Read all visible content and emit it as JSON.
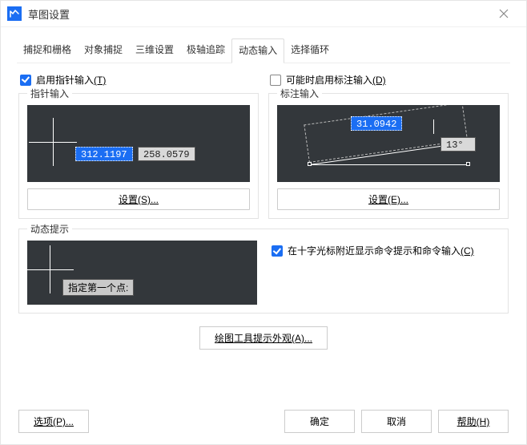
{
  "window": {
    "title": "草图设置"
  },
  "tabs": [
    "捕捉和栅格",
    "对象捕捉",
    "三维设置",
    "极轴追踪",
    "动态输入",
    "选择循环"
  ],
  "active_tab_index": 4,
  "pointer_input": {
    "checkbox_label_pre": "启用指针输入",
    "checkbox_key": "(T)",
    "group_label": "指针输入",
    "val1": "312.1197",
    "val2": "258.0579",
    "settings_btn": "设置(S)..."
  },
  "dim_input": {
    "checkbox_label_pre": "可能时启用标注输入",
    "checkbox_key": "(D)",
    "group_label": "标注输入",
    "len": "31.0942",
    "ang": "13°",
    "settings_btn": "设置(E)..."
  },
  "dyn_prompt": {
    "group_label": "动态提示",
    "hint_text": "指定第一个点:",
    "right_check_pre": "在十字光标附近显示命令提示和命令输入",
    "right_check_key": "(C)"
  },
  "appearance_btn": "绘图工具提示外观(A)...",
  "footer": {
    "options": "选项(P)...",
    "ok": "确定",
    "cancel": "取消",
    "help": "帮助(H)"
  }
}
